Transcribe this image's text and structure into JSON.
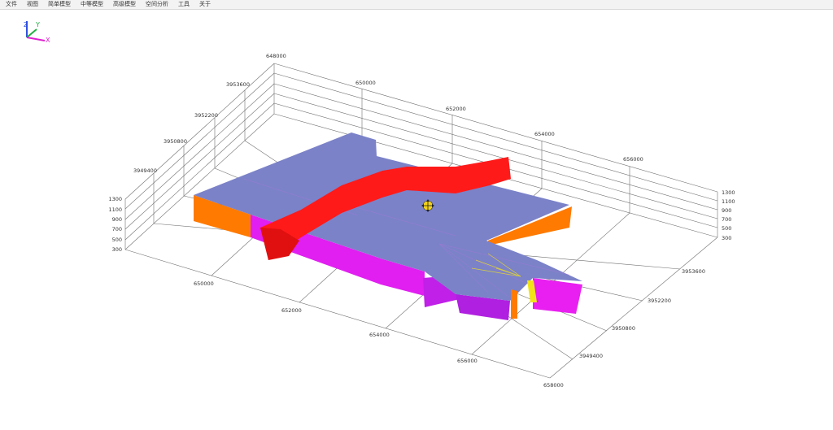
{
  "menu": {
    "items": [
      "文件",
      "视图",
      "简单模型",
      "中等模型",
      "高级模型",
      "空间分析",
      "工具",
      "关于"
    ]
  },
  "axis_triad": {
    "z": "Z",
    "y": "Y",
    "x": "X"
  },
  "axes": {
    "back_x_ticks": [
      "648000",
      "650000",
      "652000",
      "654000",
      "656000"
    ],
    "left_y_ticks": [
      "3953600",
      "3952200",
      "3950800",
      "3949400"
    ],
    "left_z_ticks": [
      "1300",
      "1100",
      "900",
      "700",
      "500",
      "300"
    ],
    "right_z_ticks": [
      "1300",
      "1100",
      "900",
      "700",
      "500",
      "300"
    ],
    "front_x_ticks": [
      "650000",
      "652000",
      "654000",
      "656000",
      "658000"
    ],
    "right_y_ticks": [
      "3953600",
      "3952200",
      "3950800",
      "3949400"
    ]
  },
  "colors": {
    "top_surface": "#7b82c8",
    "fault_red": "#ff1a1a",
    "side_orange": "#ff7a00",
    "side_magenta": "#e01ff0",
    "yellow": "#f2e21a",
    "grid": "#707070"
  }
}
